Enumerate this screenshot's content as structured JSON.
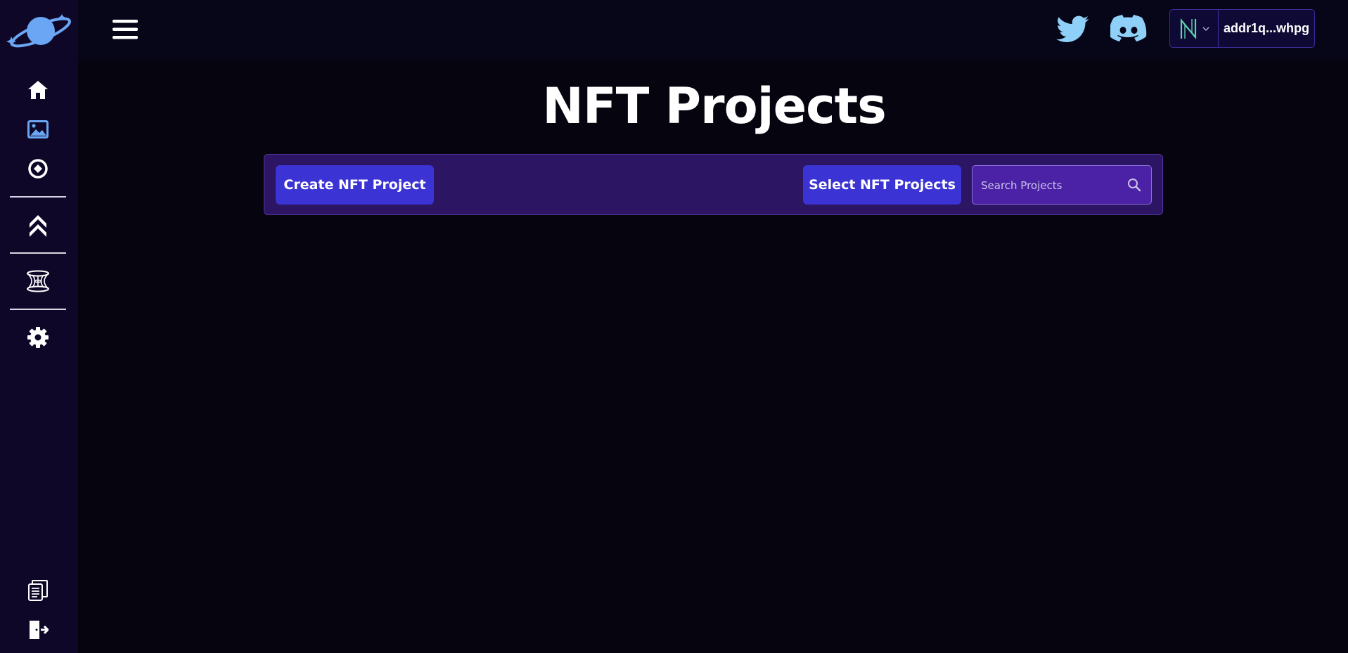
{
  "header": {
    "wallet_address": "addr1q...whpg"
  },
  "main": {
    "title": "NFT Projects",
    "create_button": "Create NFT Project",
    "select_button": "Select NFT Projects",
    "search_placeholder": "Search Projects"
  },
  "icons": {
    "logo": "planet-logo-icon",
    "menu": "hamburger-menu-icon",
    "twitter": "twitter-icon",
    "discord": "discord-icon",
    "wallet": "nami-wallet-icon",
    "sidebar": [
      "home-icon",
      "image-icon",
      "token-icon",
      "chevrons-up-icon",
      "wormhole-icon",
      "gear-icon",
      "docs-icon",
      "logout-icon"
    ],
    "search": "search-icon"
  },
  "colors": {
    "background": "#05040f",
    "sidebar": "#0f0728",
    "toolbar": "#2c1663",
    "button": "#3b33d3",
    "search_field": "#4b21a6",
    "accent_blue": "#6aa6f4"
  }
}
